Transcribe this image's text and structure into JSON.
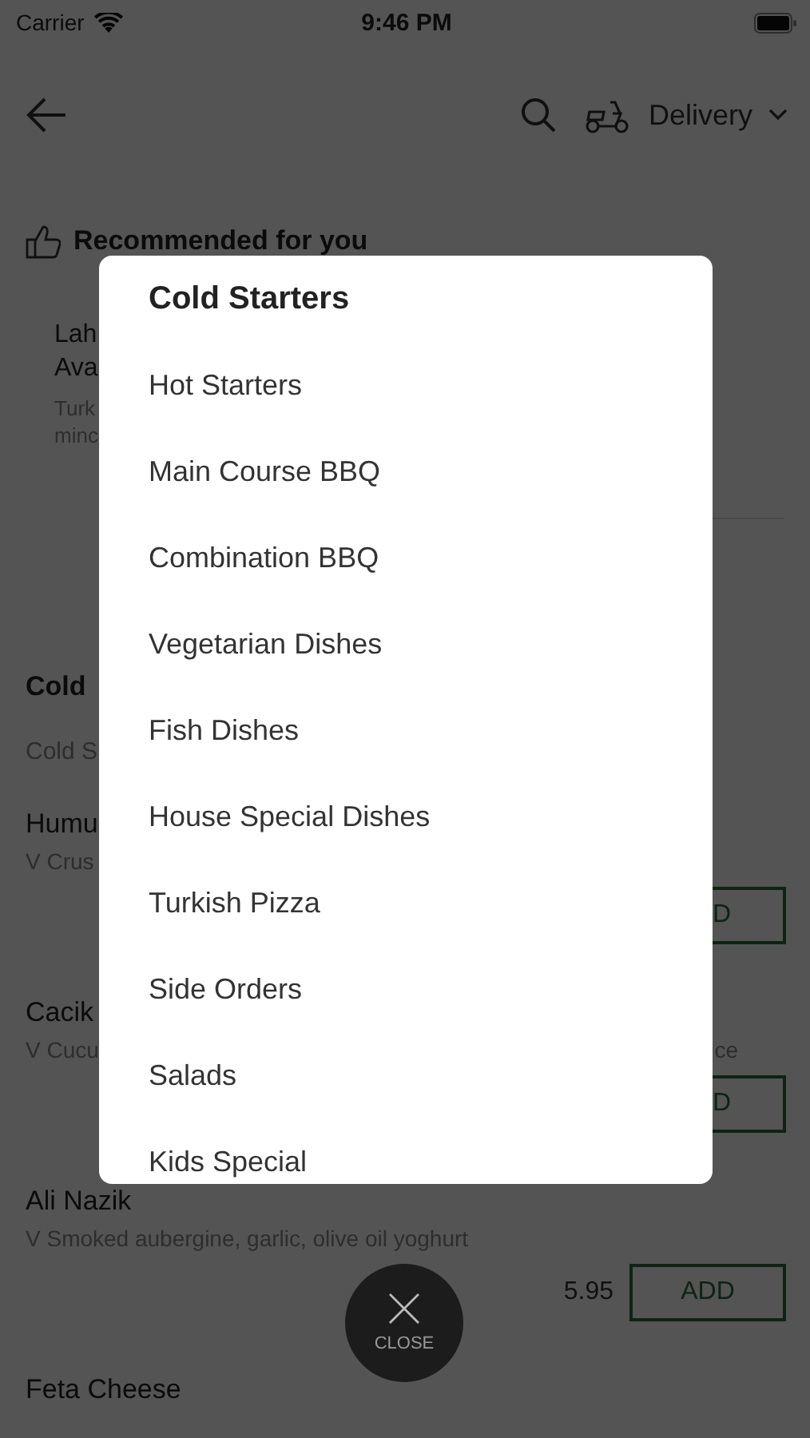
{
  "status_bar": {
    "carrier": "Carrier",
    "time": "9:46 PM"
  },
  "header": {
    "delivery_mode": "Delivery"
  },
  "recommended": {
    "title": "Recommended for you",
    "name_lines": [
      "Lah",
      "Ava"
    ],
    "description_lines": [
      "Turk",
      "minc"
    ]
  },
  "section": {
    "title": "Cold",
    "subtitle": "Cold S"
  },
  "dishes": [
    {
      "kind": "partial",
      "name": "Humu",
      "description": "V Crus",
      "add_label": "D"
    },
    {
      "kind": "partial",
      "name": "Cacik",
      "description": "V Cucu",
      "description_tail": "ce",
      "add_label": "D"
    },
    {
      "kind": "full",
      "name": "Ali Nazik",
      "description": "V Smoked aubergine, garlic, olive oil yoghurt",
      "price": "5.95",
      "add_label": "ADD"
    },
    {
      "kind": "full",
      "name": "Feta Cheese"
    }
  ],
  "categories": [
    {
      "label": "Cold Starters",
      "selected": true
    },
    {
      "label": "Hot Starters",
      "selected": false
    },
    {
      "label": "Main Course BBQ",
      "selected": false
    },
    {
      "label": "Combination BBQ",
      "selected": false
    },
    {
      "label": "Vegetarian Dishes",
      "selected": false
    },
    {
      "label": "Fish Dishes",
      "selected": false
    },
    {
      "label": "House Special Dishes",
      "selected": false
    },
    {
      "label": "Turkish Pizza",
      "selected": false
    },
    {
      "label": "Side Orders",
      "selected": false
    },
    {
      "label": "Salads",
      "selected": false
    },
    {
      "label": "Kids Special",
      "selected": false
    }
  ],
  "close_button": {
    "label": "CLOSE"
  }
}
